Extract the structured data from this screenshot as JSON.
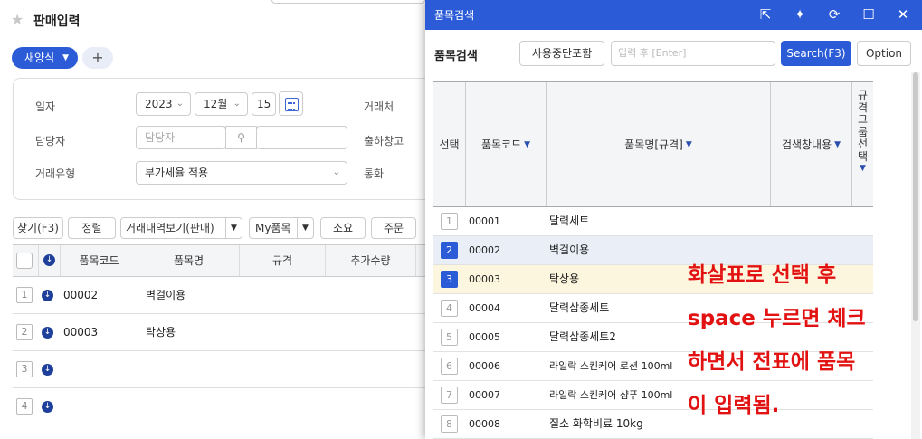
{
  "page": {
    "title": "판매입력",
    "new_format_label": "새양식",
    "add_tab_label": "+"
  },
  "form": {
    "date_label": "일자",
    "year": "2023",
    "month": "12월",
    "day": "15",
    "customer_label": "거래처",
    "staff_label": "담당자",
    "staff_placeholder": "담당자",
    "warehouse_label": "출하창고",
    "trade_type_label": "거래유형",
    "trade_type_value": "부가세율 적용",
    "currency_label": "통화"
  },
  "toolbar": {
    "find": "찾기(F3)",
    "sort": "정렬",
    "history": "거래내역보기(판매)",
    "my_items": "My품목",
    "consume": "소요",
    "order": "주문"
  },
  "grid": {
    "headers": [
      "품목코드",
      "품목명",
      "규격",
      "추가수량"
    ],
    "rows": [
      {
        "num": "1",
        "code": "00002",
        "name": "벽걸이용"
      },
      {
        "num": "2",
        "code": "00003",
        "name": "탁상용"
      },
      {
        "num": "3",
        "code": "",
        "name": ""
      },
      {
        "num": "4",
        "code": "",
        "name": ""
      }
    ]
  },
  "popup": {
    "title": "품목검색",
    "search_label": "품목검색",
    "include_discontinued": "사용중단포함",
    "input_placeholder": "입력 후 [Enter]",
    "search_button": "Search(F3)",
    "option_button": "Option",
    "headers": {
      "select": "선택",
      "code": "품목코드",
      "name": "품목명[규격]",
      "search_window": "검색창내용",
      "spec_group": "규격그룹선택"
    },
    "rows": [
      {
        "num": "1",
        "code": "00001",
        "name": "달력세트",
        "state": "normal"
      },
      {
        "num": "2",
        "code": "00002",
        "name": "벽걸이용",
        "state": "checked"
      },
      {
        "num": "3",
        "code": "00003",
        "name": "탁상용",
        "state": "active"
      },
      {
        "num": "4",
        "code": "00004",
        "name": "달력삼종세트",
        "state": "normal"
      },
      {
        "num": "5",
        "code": "00005",
        "name": "달력삼종세트2",
        "state": "normal"
      },
      {
        "num": "6",
        "code": "00006",
        "name": "라일락 스킨케어 로션 100ml",
        "state": "normal"
      },
      {
        "num": "7",
        "code": "00007",
        "name": "라일락 스킨케어 샴푸 100ml",
        "state": "normal"
      },
      {
        "num": "8",
        "code": "00008",
        "name": "질소 화학비료 10kg",
        "state": "normal"
      }
    ]
  },
  "annotation": {
    "line1": "화살표로 선택 후",
    "line2": "space 누르면 체크",
    "line3": "하면서 전표에 품목",
    "line4": "이 입력됨."
  },
  "colors": {
    "accent": "#2b5bd7",
    "annotation": "#e31212",
    "checked_row": "#e9eef7",
    "active_row": "#fdf6df"
  }
}
